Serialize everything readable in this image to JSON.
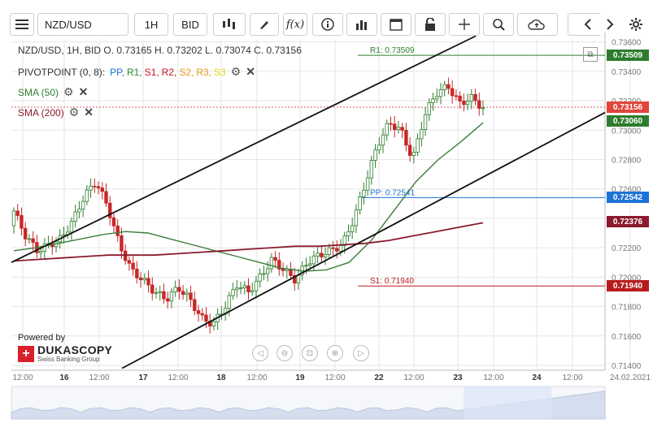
{
  "toolbar": {
    "symbol": "NZD/USD",
    "timeframe": "1H",
    "price_type": "BID"
  },
  "legend": {
    "ohlc": "NZD/USD, 1H, BID   O. 0.73165 H. 0.73202 L. 0.73074 C. 0.73156",
    "pivot_label": "PIVOTPOINT (0, 8)",
    "pivot_sep": ":",
    "pivot_items": [
      {
        "label": "PP,",
        "color": "#1e73d8"
      },
      {
        "label": "R1,",
        "color": "#2e8b2e"
      },
      {
        "label": "S1,",
        "color": "#c4161c"
      },
      {
        "label": "R2,",
        "color": "#c4161c"
      },
      {
        "label": "S2,",
        "color": "#e89a1a"
      },
      {
        "label": "R3,",
        "color": "#e89a1a"
      },
      {
        "label": "S3",
        "color": "#e8d51a"
      }
    ],
    "sma50": "SMA (50)",
    "sma200": "SMA (200)"
  },
  "branding": {
    "powered": "Powered by",
    "name": "DUKASCOPY",
    "sub": "Swiss Banking Group"
  },
  "levels": {
    "r1": "R1: 0.73509",
    "pp": "PP: 0.72541",
    "s1": "S1: 0.71940"
  },
  "price_labels": [
    {
      "text": "0.73509",
      "color": "#2e7d2e",
      "value": 0.73509
    },
    {
      "text": "0.73156",
      "color": "#e0463c",
      "value": 0.73156
    },
    {
      "text": "0.73060",
      "color": "#2e7d2e",
      "value": 0.7306
    },
    {
      "text": "0.72542",
      "color": "#1e73d8",
      "value": 0.72542
    },
    {
      "text": "0.72376",
      "color": "#8b1a2e",
      "value": 0.72376
    },
    {
      "text": "0.71940",
      "color": "#b71c1c",
      "value": 0.7194
    }
  ],
  "colors": {
    "candle_up": "#2e7d2e",
    "candle_down": "#c62828",
    "sma50": "#3a7d3a",
    "sma200": "#8b1a2e",
    "channel": "#111111",
    "grid": "#e6e6e6"
  },
  "chart_data": {
    "type": "candlestick",
    "symbol": "NZD/USD",
    "timeframe": "1H",
    "ylim": [
      0.714,
      0.7362
    ],
    "yticks": [
      "0.73600",
      "0.73400",
      "0.73200",
      "0.73000",
      "0.72800",
      "0.72600",
      "0.72400",
      "0.72200",
      "0.72000",
      "0.71800",
      "0.71600",
      "0.71400"
    ],
    "xticks": [
      "12:00",
      "16",
      "12:00",
      "17",
      "12:00",
      "18",
      "12:00",
      "19",
      "12:00",
      "22",
      "12:00",
      "23",
      "12:00",
      "24",
      "12:00",
      "24.02.2021"
    ],
    "series": [
      {
        "name": "SMA (50)",
        "values": [
          0.7218,
          0.722,
          0.7223,
          0.7226,
          0.7229,
          0.7231,
          0.723,
          0.7226,
          0.7222,
          0.7218,
          0.7214,
          0.721,
          0.7206,
          0.7204,
          0.7205,
          0.721,
          0.7225,
          0.7245,
          0.7265,
          0.728,
          0.7292,
          0.7305
        ]
      },
      {
        "name": "SMA (200)",
        "values": [
          0.7211,
          0.7212,
          0.7213,
          0.7214,
          0.7215,
          0.7215,
          0.7215,
          0.7216,
          0.7217,
          0.7218,
          0.7219,
          0.722,
          0.7221,
          0.7221,
          0.7222,
          0.7223,
          0.7225,
          0.7228,
          0.7231,
          0.7234,
          0.7237
        ]
      }
    ],
    "closes": [
      0.7245,
      0.7228,
      0.7218,
      0.7222,
      0.7226,
      0.7238,
      0.7255,
      0.7265,
      0.7248,
      0.7222,
      0.7205,
      0.7198,
      0.719,
      0.7185,
      0.7193,
      0.7185,
      0.7172,
      0.7168,
      0.718,
      0.7195,
      0.719,
      0.72,
      0.7212,
      0.7205,
      0.7198,
      0.721,
      0.7215,
      0.7218,
      0.7222,
      0.724,
      0.7265,
      0.729,
      0.7305,
      0.73,
      0.728,
      0.731,
      0.7325,
      0.733,
      0.7318,
      0.7322,
      0.7315
    ]
  },
  "nav": {
    "controls": [
      "prev-icon",
      "zoom-out-icon",
      "reset-icon",
      "zoom-in-icon",
      "next-icon"
    ]
  }
}
